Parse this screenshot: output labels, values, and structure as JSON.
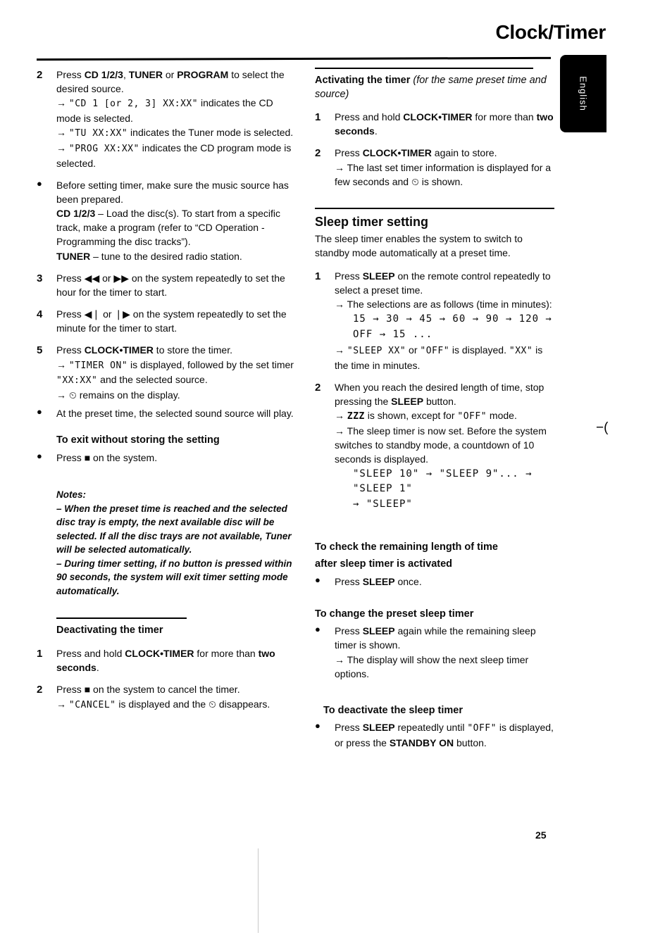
{
  "header": {
    "title": "Clock/Timer",
    "language_tab": "English",
    "page_number": "25"
  },
  "left_column": {
    "step2": {
      "marker": "2",
      "text_1": "Press ",
      "bold_1": "CD 1/2/3",
      "text_2": ", ",
      "bold_2": "TUNER",
      "text_3": " or ",
      "bold_3": "PROGRAM",
      "text_4": " to select the desired source.",
      "sub_1_arrow": "→",
      "sub_1_lcd": "\"CD 1 [or 2, 3]  XX:XX\"",
      "sub_1_text": " indicates the CD mode is selected.",
      "sub_2_arrow": "→",
      "sub_2_lcd": "\"TU XX:XX\"",
      "sub_2_text": " indicates the Tuner mode is selected.",
      "sub_3_arrow": "→",
      "sub_3_lcd": "\"PROG XX:XX\"",
      "sub_3_text": " indicates the CD program mode is selected."
    },
    "bullet_prepare": {
      "marker": "●",
      "line_1": "Before setting timer, make sure the music source has been prepared.",
      "bold_cd": "CD 1/2/3",
      "cd_text": " – Load the disc(s). To start from a specific track, make a program (refer to “CD Operation - Programming the disc tracks”).",
      "bold_tuner": "TUNER",
      "tuner_text": " – tune to the desired radio station."
    },
    "step3": {
      "marker": "3",
      "text": "Press ◀◀ or ▶▶ on the system repeatedly to set the hour for the timer to start."
    },
    "step4": {
      "marker": "4",
      "text": "Press ◀❘ or ❘▶ on the system repeatedly to set the minute for the timer to start."
    },
    "step5": {
      "marker": "5",
      "text_1": "Press ",
      "bold_1": "CLOCK•TIMER",
      "text_2": " to store the timer.",
      "sub_1_arrow": "→",
      "sub_1_lcd": "\"TIMER ON\"",
      "sub_1_text": " is displayed, followed by the set timer ",
      "sub_1_lcd2": "\"XX:XX\"",
      "sub_1_text2": " and the selected source.",
      "sub_2_arrow": "→",
      "sub_2_text": "⏲ remains on the display."
    },
    "bullet_preset": {
      "marker": "●",
      "text": "At the preset time, the selected sound source will play."
    },
    "exit_section": {
      "heading": "To exit without storing the setting",
      "marker": "●",
      "text_1": "Press ",
      "stop_icon": "■",
      "text_2": " on the system."
    },
    "notes": {
      "label": "Notes:",
      "note_1": "– When the preset time is reached and the selected disc tray is empty, the next available disc will be selected. If all the disc trays are not available, Tuner will be selected automatically.",
      "note_2": "– During timer setting, if no button is pressed within 90 seconds, the system will exit timer setting mode automatically."
    },
    "deactivating": {
      "heading": "Deactivating the timer",
      "step1": {
        "marker": "1",
        "text_1": "Press and hold ",
        "bold_1": "CLOCK•TIMER",
        "text_2": " for more than ",
        "bold_2": "two seconds",
        "text_3": "."
      },
      "step2": {
        "marker": "2",
        "text_1": "Press ",
        "stop_icon": "■",
        "text_2": " on the system to cancel the timer.",
        "sub_arrow": "→",
        "sub_lcd": "\"CANCEL\"",
        "sub_text": " is displayed and the ⏲ disappears."
      }
    }
  },
  "right_column": {
    "activating": {
      "heading": "Activating the timer",
      "heading_italic": " (for the same preset time and source)",
      "step1": {
        "marker": "1",
        "text_1": "Press and hold ",
        "bold_1": "CLOCK•TIMER",
        "text_2": " for more than ",
        "bold_2": "two seconds",
        "text_3": "."
      },
      "step2": {
        "marker": "2",
        "text_1": "Press ",
        "bold_1": "CLOCK•TIMER",
        "text_2": " again to store.",
        "sub_arrow": "→",
        "sub_text": "The last set timer information is displayed for a few seconds and ⏲ is shown."
      }
    },
    "sleep": {
      "heading": "Sleep timer setting",
      "intro": "The sleep timer enables the system to switch to standby mode automatically at a preset time.",
      "step1": {
        "marker": "1",
        "text_1": "Press ",
        "bold_1": "SLEEP",
        "text_2": " on the remote control repeatedly to select a preset time.",
        "sub_1_arrow": "→",
        "sub_1_text": "The selections are as follows (time in minutes):",
        "sequence_line_1": "15 → 30 → 45 → 60 → 90 → 120 →",
        "sequence_line_2": "OFF → 15 ...",
        "sub_2_arrow": "→",
        "sub_2_lcd": "\"SLEEP XX\"",
        "sub_2_text_1": " or ",
        "sub_2_lcd2": "\"OFF\"",
        "sub_2_text_2": " is displayed. ",
        "sub_2_lcd3": "\"XX\"",
        "sub_2_text_3": " is the time in minutes."
      },
      "step2": {
        "marker": "2",
        "text_1": "When you reach the desired length of time, stop pressing the ",
        "bold_1": "SLEEP",
        "text_2": " button.",
        "sub_1_arrow": "→",
        "sub_1_lcd": "ZZZ",
        "sub_1_text": " is shown, except for ",
        "sub_1_lcd2": "\"OFF\"",
        "sub_1_text2": " mode.",
        "sub_2_arrow": "→",
        "sub_2_text": "The sleep timer is now set. Before the system switches to standby mode, a countdown of 10 seconds is displayed.",
        "countdown_line_1": "\"SLEEP 10\" → \"SLEEP 9\"... → \"SLEEP 1\"",
        "countdown_line_2": "→ \"SLEEP\""
      }
    },
    "check_remaining": {
      "heading_line_1": "To check the remaining length of time",
      "heading_line_2": "after sleep timer is activated",
      "marker": "●",
      "text_1": "Press ",
      "bold_1": "SLEEP",
      "text_2": " once."
    },
    "change_preset": {
      "heading": "To change the preset sleep timer",
      "marker": "●",
      "text_1": "Press ",
      "bold_1": "SLEEP",
      "text_2": " again while the remaining sleep timer is shown.",
      "sub_arrow": "→",
      "sub_text": "The display will show the next sleep timer options."
    },
    "deactivate_sleep": {
      "heading": "To deactivate the sleep timer",
      "marker": "●",
      "text_1": "Press ",
      "bold_1": "SLEEP",
      "text_2": " repeatedly until ",
      "lcd_1": "\"OFF\"",
      "text_3": " is displayed, or press the ",
      "bold_2": "STANDBY ON",
      "text_4": " button."
    }
  }
}
